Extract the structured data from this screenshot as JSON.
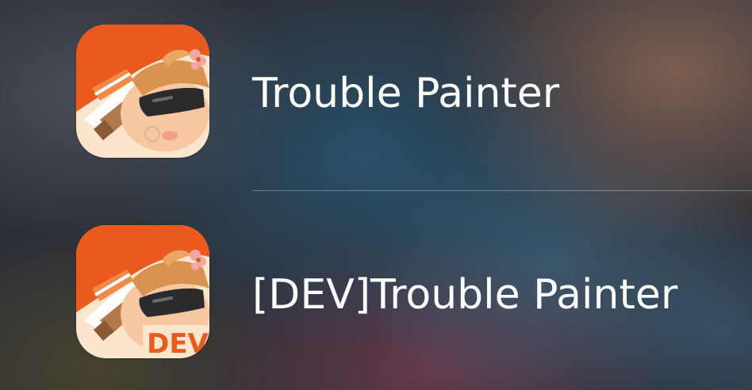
{
  "apps": [
    {
      "name": "Trouble Painter",
      "icon": "trouble-painter-app-icon"
    },
    {
      "name": "[DEV]Trouble Painter",
      "icon": "trouble-painter-dev-app-icon",
      "badge": "DEV"
    }
  ],
  "colors": {
    "icon_orange": "#ea5a1f",
    "icon_cream": "#fbe3c8",
    "skin": "#f6c7a0",
    "hair": "#d9924f",
    "glasses": "#2b2b2e",
    "badge_text": "#ea5a1f",
    "label_text": "#ffffff",
    "divider": "#8a9098"
  }
}
